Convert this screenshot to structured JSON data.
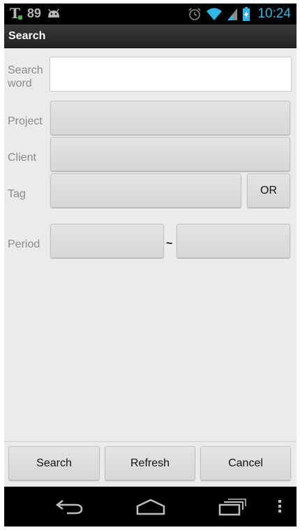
{
  "status_bar": {
    "carrier_icon": "T",
    "battery_level": "89",
    "notification_icon": "android-icon",
    "icons": [
      "alarm-icon",
      "wifi-icon",
      "signal-icon",
      "battery-charging-icon"
    ],
    "time": "10:24"
  },
  "action_bar": {
    "title": "Search"
  },
  "form": {
    "search_word_label": "Search\nword",
    "search_word_value": "",
    "project_label": "Project",
    "project_value": "",
    "client_label": "Client",
    "client_value": "",
    "tag_label": "Tag",
    "tag_value": "",
    "tag_mode_label": "OR",
    "period_label": "Period",
    "period_from": "",
    "period_separator": "~",
    "period_to": ""
  },
  "bottom_buttons": {
    "search_label": "Search",
    "refresh_label": "Refresh",
    "cancel_label": "Cancel"
  },
  "nav_bar": {
    "icons": [
      "back-icon",
      "home-icon",
      "recent-apps-icon",
      "overflow-menu-icon"
    ]
  },
  "colors": {
    "accent": "#33b5e5",
    "background": "#ebebeb",
    "bar": "#000000"
  }
}
